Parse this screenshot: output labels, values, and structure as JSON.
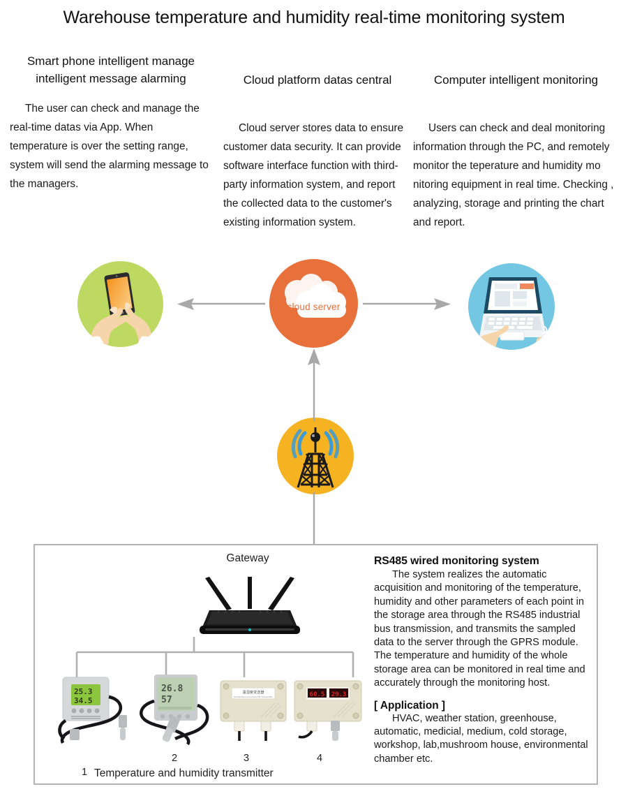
{
  "title": "Warehouse temperature and humidity real-time monitoring system",
  "columns": {
    "phone": {
      "heading": "Smart phone intelligent manage intelligent message alarming",
      "body": "The user can check and manage the real-time datas via App. When temperature is over the setting range, system will send the alarming message to the managers."
    },
    "cloud": {
      "heading": "Cloud platform datas central",
      "body": "Cloud server stores data to ensure customer data security. It can provide software interface function with third-party information system, and report the collected data to the customer's existing information system."
    },
    "pc": {
      "heading": "Computer intelligent monitoring",
      "body": "Users can check and deal monitoring information through the PC, and remotely monitor the teperature and humidity mo nitoring equipment in real time. Checking , analyzing, storage and printing the chart and report."
    }
  },
  "icons": {
    "phone_icon_name": "smartphone-in-hands-icon",
    "cloud_icon_name": "cloud-server-icon",
    "cloud_label": "cloud server",
    "pc_icon_name": "laptop-computer-icon",
    "tower_icon_name": "radio-transmission-tower-icon"
  },
  "panel": {
    "gateway_label": "Gateway",
    "gateway_icon_name": "wireless-router-icon",
    "rs485": {
      "heading": "RS485 wired monitoring system",
      "body": "The system realizes the automatic acquisition and monitoring of the temperature, humidity and other parameters of each point in the storage area through the RS485 industrial bus transmission, and transmits the sampled data to the server through the GPRS module. The temperature and humidity of the whole storage area can be monitored in real time and accurately through the monitoring host."
    },
    "application": {
      "heading": "[ Application ]",
      "body": "HVAC, weather station, greenhouse, automatic, medicial, medium, cold storage, workshop, lab,mushroom house, environmental chamber etc."
    },
    "devices": [
      {
        "number": "1",
        "name": "wall-mount-temp-humidity-transmitter",
        "display_temp": "25.3",
        "display_humidity": "34.5",
        "display_color": "#8cc63f"
      },
      {
        "number": "2",
        "name": "lcd-temp-humidity-transmitter",
        "display_temp": "26.8",
        "display_humidity": "57",
        "display_color": "#b9cfaf"
      },
      {
        "number": "3",
        "name": "enclosure-temp-humidity-transmitter",
        "label_text": "温湿度变送器",
        "label_sub": "Temperature and Humidity Transmitter"
      },
      {
        "number": "4",
        "name": "led-display-temp-humidity-transmitter",
        "display_humidity": "60.5",
        "display_temp": "29.3",
        "display_color": "#e01f1f"
      }
    ],
    "device_caption": "Temperature and humidity transmitter"
  },
  "colors": {
    "phone_circle": "#bdd962",
    "cloud_circle": "#e8703a",
    "pc_circle": "#74c7e3",
    "tower_circle": "#f5b322",
    "connector_gray": "#a8a8a8",
    "panel_border": "#b3b3b3"
  }
}
